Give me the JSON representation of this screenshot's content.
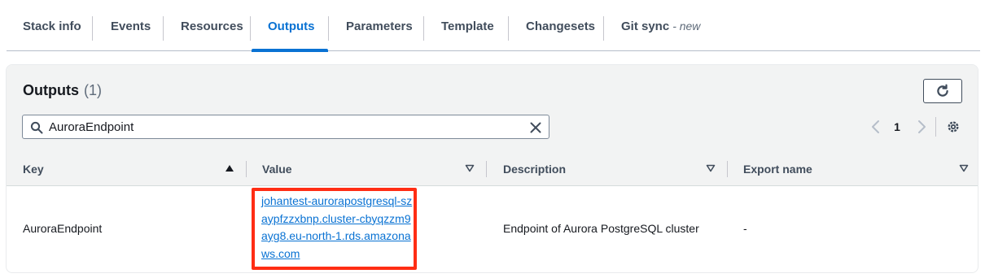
{
  "tabs": [
    {
      "label": "Stack info"
    },
    {
      "label": "Events"
    },
    {
      "label": "Resources"
    },
    {
      "label": "Outputs",
      "active": true
    },
    {
      "label": "Parameters"
    },
    {
      "label": "Template"
    },
    {
      "label": "Changesets"
    },
    {
      "label": "Git sync",
      "suffix": "- new"
    }
  ],
  "panel": {
    "title": "Outputs",
    "count": "(1)"
  },
  "search": {
    "value": "AuroraEndpoint",
    "placeholder": ""
  },
  "pagination": {
    "current_page": "1"
  },
  "table": {
    "columns": [
      "Key",
      "Value",
      "Description",
      "Export name"
    ],
    "rows": [
      {
        "key": "AuroraEndpoint",
        "value": "johantest-aurorapostgresql-szaypfzzxbnp.cluster-cbyqzzm9ayg8.eu-north-1.rds.amazonaws.com",
        "description": "Endpoint of Aurora PostgreSQL cluster",
        "export_name": "-"
      }
    ]
  },
  "colors": {
    "accent": "#0972d3",
    "highlight": "#ff2d14",
    "header_bg": "#f2f3f3"
  },
  "icons": [
    "refresh-icon",
    "search-icon",
    "clear-icon",
    "chevron-left-icon",
    "chevron-right-icon",
    "settings-icon",
    "sort-ascending-icon",
    "sort-descending-icon"
  ]
}
